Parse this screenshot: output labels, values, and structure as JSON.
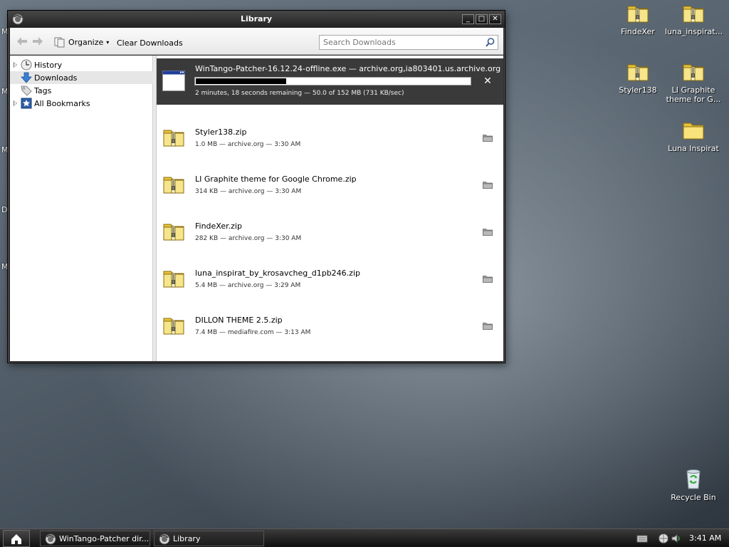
{
  "window": {
    "title": "Library",
    "controls": {
      "minimize": "_",
      "maximize": "□",
      "close": "✕"
    }
  },
  "toolbar": {
    "organize_label": "Organize",
    "clear_label": "Clear Downloads",
    "search_placeholder": "Search Downloads"
  },
  "sidebar": {
    "items": [
      {
        "label": "History",
        "icon": "clock-icon",
        "expandable": true
      },
      {
        "label": "Downloads",
        "icon": "download-arrow-icon",
        "expandable": false,
        "selected": true
      },
      {
        "label": "Tags",
        "icon": "tag-icon",
        "expandable": false
      },
      {
        "label": "All Bookmarks",
        "icon": "bookmark-star-icon",
        "expandable": true
      }
    ]
  },
  "active_download": {
    "name": "WinTango-Patcher-16.12.24-offline.exe — archive.org,ia803401.us.archive.org",
    "status": "2 minutes, 18 seconds remaining — 50.0 of 152 MB (731 KB/sec)",
    "progress_fraction": 0.33,
    "cancel": "✕"
  },
  "downloads": [
    {
      "name": "Styler138.zip",
      "meta": "1.0 MB — archive.org — 3:30 AM"
    },
    {
      "name": "LI Graphite theme for Google Chrome.zip",
      "meta": "314 KB — archive.org — 3:30 AM"
    },
    {
      "name": "FindeXer.zip",
      "meta": "282 KB — archive.org — 3:30 AM"
    },
    {
      "name": "luna_inspirat_by_krosavcheg_d1pb246.zip",
      "meta": "5.4 MB — archive.org — 3:29 AM"
    },
    {
      "name": "DILLON THEME 2.5.zip",
      "meta": "7.4 MB — mediafire.com — 3:13 AM"
    }
  ],
  "desktop": {
    "icons": [
      {
        "label": "FindeXer",
        "icon": "zip-folder-icon"
      },
      {
        "label": "luna_inspirat...",
        "icon": "zip-folder-icon"
      },
      {
        "label": "Styler138",
        "icon": "zip-folder-icon"
      },
      {
        "label": "LI Graphite theme for G...",
        "icon": "zip-folder-icon"
      },
      {
        "label": "Luna Inspirat",
        "icon": "folder-icon"
      }
    ],
    "recycle_bin": "Recycle Bin",
    "edge_letters": [
      "M",
      "M",
      "D",
      "M",
      "M"
    ]
  },
  "taskbar": {
    "tasks": [
      {
        "label": "WinTango-Patcher dir...",
        "icon": "firefox-icon"
      },
      {
        "label": "Library",
        "icon": "firefox-icon"
      }
    ],
    "clock": "3:41 AM"
  },
  "colors": {
    "titlebar": "#2b2b2b",
    "active_row": "#3a3a3a",
    "selected_tree": "#e6e6e6",
    "progress_fill": "#000000",
    "folder_yellow": "#f2d64b"
  }
}
